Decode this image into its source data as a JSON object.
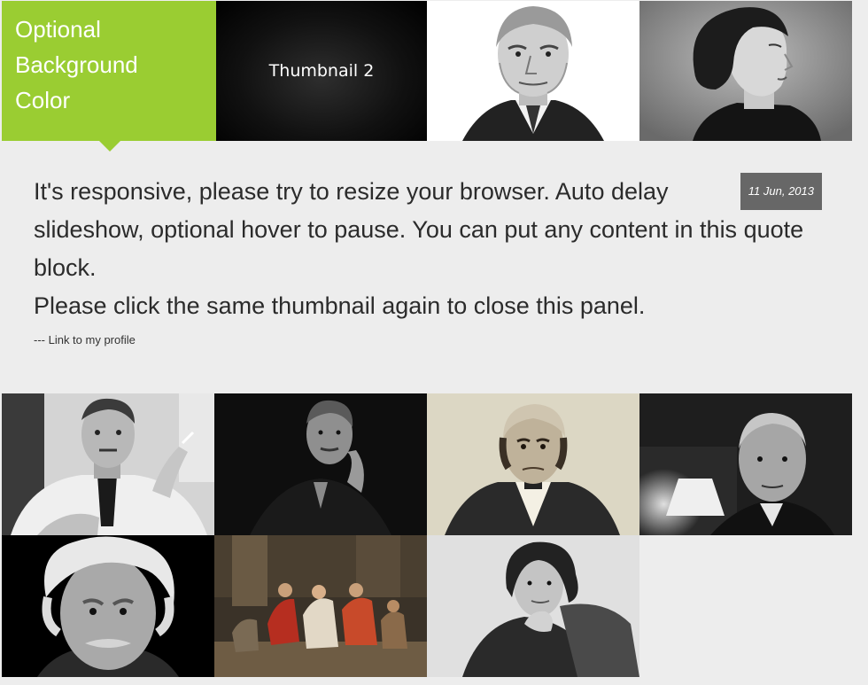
{
  "top_row": {
    "color_tile_label": [
      "Optional",
      "Background",
      "Color"
    ],
    "thumbnail_2_label": "Thumbnail 2",
    "portraits": [
      "portrait-elderly-man-photo",
      "portrait-woman-profile-photo"
    ]
  },
  "quote": {
    "line_1": "It's responsive, please try to resize your browser. Auto delay slideshow, optional hover to pause. You can put any content in this quote block.",
    "line_2": "Please click the same thumbnail again to close this panel.",
    "date": "11 Jun, 2013",
    "link_text": "--- Link to my profile"
  },
  "colors": {
    "accent_green": "#9acd32",
    "panel_bg": "#ededed",
    "date_badge_bg": "#676767"
  }
}
